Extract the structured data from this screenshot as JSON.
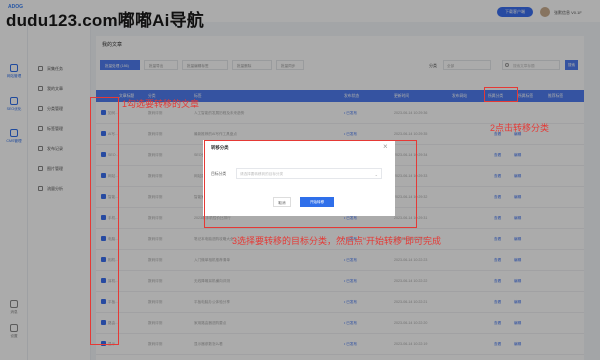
{
  "watermark": "dudu123.com嘟嘟Ai导航",
  "header": {
    "logo": "ADOG",
    "download_label": "下载客户端",
    "user_name": "张默信息 V0.1F"
  },
  "rail": [
    {
      "label": "网站管理"
    },
    {
      "label": "SEO优化"
    },
    {
      "label": "CMS管理"
    }
  ],
  "rail_bottom": [
    {
      "label": "消息"
    },
    {
      "label": "设置"
    }
  ],
  "sub_sidebar": [
    "采集任务",
    "我的文章",
    "分类管理",
    "标签管理",
    "发布记录",
    "图片管理",
    "流量分析"
  ],
  "main": {
    "title": "我的文章",
    "toolbar": [
      "批量处理 (186)",
      "批量导出",
      "批量编辑标签",
      "批量删除",
      "批量同步"
    ],
    "filter_label": "分类",
    "filter_placeholder": "全部",
    "search_placeholder": "搜索文章标题",
    "search_button": "搜索"
  },
  "table": {
    "headers": [
      "文章标题",
      "分类",
      "标签",
      "发布状态",
      "更新时间",
      "发布网站",
      "所属分类",
      "所属标签",
      "推荐标签"
    ],
    "rows": [
      {
        "title": "如何...",
        "cat": "数码评测",
        "summary": "人工智能的发展历程及未来趋势",
        "status": "• 已发布",
        "time": "2023-06-14 10:29:36"
      },
      {
        "title": "AI写...",
        "cat": "数码评测",
        "summary": "最新推荐的AI写作工具盘点",
        "status": "• 已发布",
        "time": "2023-06-14 10:29:35"
      },
      {
        "title": "SEO...",
        "cat": "数码评测",
        "summary": "SEO优化技巧与实战经验分享",
        "status": "• 已发布",
        "time": "2023-06-14 10:29:34"
      },
      {
        "title": "网站...",
        "cat": "数码评测",
        "summary": "网站建设从入门到精通",
        "status": "• 已发布",
        "time": "2023-06-14 10:29:33"
      },
      {
        "title": "智能...",
        "cat": "数码评测",
        "summary": "智能家居产品选购指南",
        "status": "• 已发布",
        "time": "2023-06-14 10:29:32"
      },
      {
        "title": "手机...",
        "cat": "数码评测",
        "summary": "2023年手机性价比排行",
        "status": "• 已发布",
        "time": "2023-06-14 10:29:31"
      },
      {
        "title": "电脑...",
        "cat": "数码评测",
        "summary": "笔记本电脑选购攻略大全",
        "status": "• 已发布",
        "time": "2023-06-14 10:22:24"
      },
      {
        "title": "相机...",
        "cat": "数码评测",
        "summary": "入门微单相机推荐清单",
        "status": "• 已发布",
        "time": "2023-06-14 10:22:23"
      },
      {
        "title": "耳机...",
        "cat": "数码评测",
        "summary": "无线降噪耳机横向评测",
        "status": "• 已发布",
        "time": "2023-06-14 10:22:22"
      },
      {
        "title": "平板...",
        "cat": "数码评测",
        "summary": "平板电脑办公体验分享",
        "status": "• 已发布",
        "time": "2023-06-14 10:22:21"
      },
      {
        "title": "路由...",
        "cat": "数码评测",
        "summary": "家用路由器选购要点",
        "status": "• 已发布",
        "time": "2023-06-14 10:22:20"
      },
      {
        "title": "显示...",
        "cat": "数码评测",
        "summary": "显示器参数怎么看",
        "status": "• 已发布",
        "time": "2023-06-14 10:22:19"
      }
    ],
    "row_actions": [
      "查看",
      "编辑"
    ]
  },
  "dialog": {
    "title": "转移分类",
    "field_label": "目标分类",
    "placeholder": "请选择要转移到的目标分类",
    "cancel": "取消",
    "start": "开始转移"
  },
  "annotations": {
    "step1": "1勾选要转移的文章",
    "step2": "2点击转移分类",
    "step3": "3选择要转移的目标分类，然后点“开始转移”即可完成"
  }
}
